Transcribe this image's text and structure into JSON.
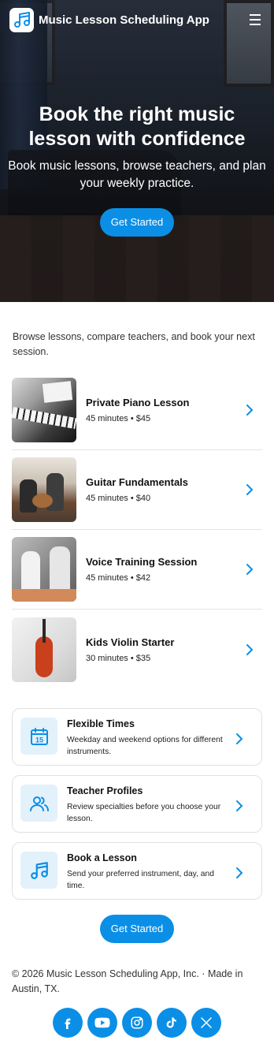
{
  "header": {
    "app_name": "Music Lesson Scheduling App"
  },
  "hero": {
    "title": "Book the right music lesson with confidence",
    "subtitle": "Book music lessons, browse teachers, and plan your weekly practice.",
    "cta_label": "Get Started"
  },
  "intro": "Browse lessons, compare teachers, and book your next session.",
  "lessons": [
    {
      "title": "Private Piano Lesson",
      "meta": "45 minutes • $45"
    },
    {
      "title": "Guitar Fundamentals",
      "meta": "45 minutes • $40"
    },
    {
      "title": "Voice Training Session",
      "meta": "45 minutes • $42"
    },
    {
      "title": "Kids Violin Starter",
      "meta": "30 minutes • $35"
    }
  ],
  "features": [
    {
      "title": "Flexible Times",
      "desc": "Weekday and weekend options for different instruments.",
      "icon": "calendar-icon",
      "icon_text": "15"
    },
    {
      "title": "Teacher Profiles",
      "desc": "Review specialties before you choose your lesson.",
      "icon": "users-icon"
    },
    {
      "title": "Book a Lesson",
      "desc": "Send your preferred instrument, day, and time.",
      "icon": "music-note-icon"
    }
  ],
  "cta_label": "Get Started",
  "footer": {
    "text": "© 2026 Music Lesson Scheduling App, Inc. · Made in Austin, TX.",
    "socials": [
      "facebook",
      "youtube",
      "instagram",
      "tiktok",
      "x"
    ]
  },
  "colors": {
    "accent": "#0b8fe6",
    "icon_bg": "#e3f1fb"
  }
}
